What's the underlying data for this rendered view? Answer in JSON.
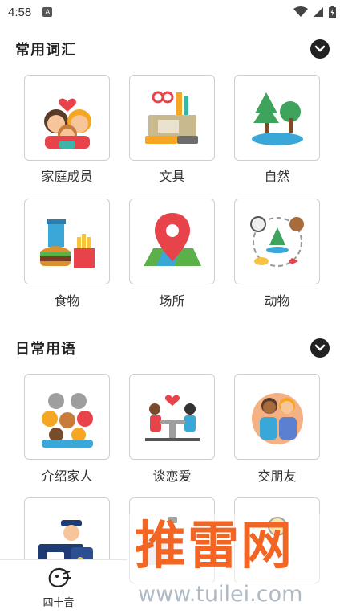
{
  "status_bar": {
    "time": "4:58",
    "notification_letter": "A"
  },
  "sections": [
    {
      "title": "常用词汇",
      "items": [
        {
          "label": "家庭成员",
          "icon": "family-icon"
        },
        {
          "label": "文具",
          "icon": "stationery-icon"
        },
        {
          "label": "自然",
          "icon": "nature-icon"
        },
        {
          "label": "食物",
          "icon": "food-icon"
        },
        {
          "label": "场所",
          "icon": "map-pin-icon"
        },
        {
          "label": "动物",
          "icon": "animals-icon"
        }
      ]
    },
    {
      "title": "日常用语",
      "items": [
        {
          "label": "介绍家人",
          "icon": "family-group-icon"
        },
        {
          "label": "谈恋爱",
          "icon": "dating-icon"
        },
        {
          "label": "交朋友",
          "icon": "friends-icon"
        },
        {
          "label": "",
          "icon": "police-icon"
        },
        {
          "label": "",
          "icon": "partial-icon"
        },
        {
          "label": "",
          "icon": "partial-person-icon"
        }
      ]
    }
  ],
  "bottom_nav": {
    "label": "四十音",
    "icon": "gojuon-icon"
  },
  "watermark": {
    "text": "推雷网",
    "url": "www.tuilei.com"
  },
  "colors": {
    "accent": "#f26522",
    "card_border": "#cfcfcf",
    "text": "#222222"
  }
}
